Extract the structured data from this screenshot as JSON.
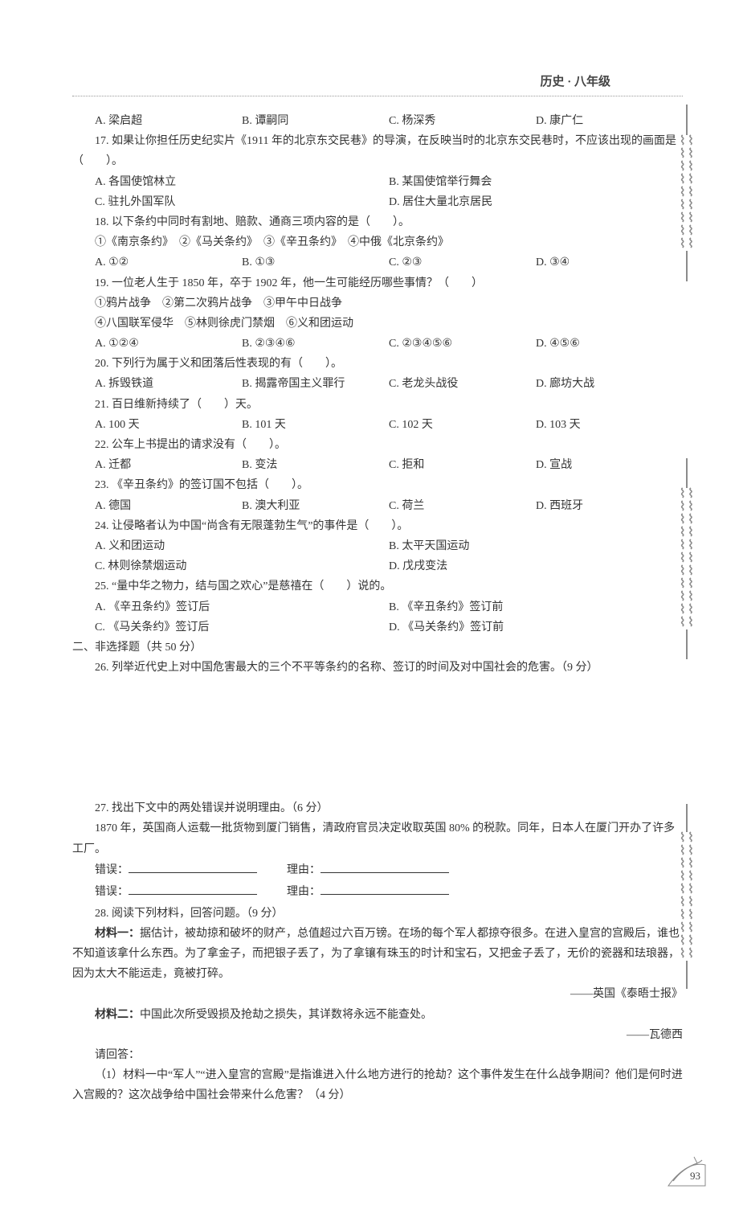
{
  "header": "历史 · 八年级",
  "page_number": "93",
  "q16": {
    "options": {
      "A": "A. 梁启超",
      "B": "B. 谭嗣同",
      "C": "C. 杨深秀",
      "D": "D. 康广仁"
    }
  },
  "q17": {
    "stem": "17. 如果让你担任历史纪实片《1911 年的北京东交民巷》的导演，在反映当时的北京东交民巷时，不应该出现的画面是（　　）。",
    "options": {
      "A": "A. 各国使馆林立",
      "B": "B. 某国使馆举行舞会",
      "C": "C. 驻扎外国军队",
      "D": "D. 居住大量北京居民"
    }
  },
  "q18": {
    "stem": "18. 以下条约中同时有割地、赔款、通商三项内容的是（　　）。",
    "items": "①《南京条约》　②《马关条约》　③《辛丑条约》　④中俄《北京条约》",
    "options": {
      "A": "A. ①②",
      "B": "B. ①③",
      "C": "C. ②③",
      "D": "D. ③④"
    }
  },
  "q19": {
    "stem": "19. 一位老人生于 1850 年，卒于 1902 年，他一生可能经历哪些事情？（　　）",
    "items1": "①鸦片战争　②第二次鸦片战争　③甲午中日战争",
    "items2": "④八国联军侵华　⑤林则徐虎门禁烟　⑥义和团运动",
    "options": {
      "A": "A. ①②④",
      "B": "B. ②③④⑥",
      "C": "C. ②③④⑤⑥",
      "D": "D. ④⑤⑥"
    }
  },
  "q20": {
    "stem": "20. 下列行为属于义和团落后性表现的有（　　）。",
    "options": {
      "A": "A. 拆毁铁道",
      "B": "B. 揭露帝国主义罪行",
      "C": "C. 老龙头战役",
      "D": "D. 廊坊大战"
    }
  },
  "q21": {
    "stem": "21. 百日维新持续了（　　）天。",
    "options": {
      "A": "A. 100 天",
      "B": "B. 101 天",
      "C": "C. 102 天",
      "D": "D. 103 天"
    }
  },
  "q22": {
    "stem": "22. 公车上书提出的请求没有（　　）。",
    "options": {
      "A": "A. 迁都",
      "B": "B. 变法",
      "C": "C. 拒和",
      "D": "D. 宣战"
    }
  },
  "q23": {
    "stem": "23. 《辛丑条约》的签订国不包括（　　）。",
    "options": {
      "A": "A. 德国",
      "B": "B. 澳大利亚",
      "C": "C. 荷兰",
      "D": "D. 西班牙"
    }
  },
  "q24": {
    "stem": "24. 让侵略者认为中国“尚含有无限蓬勃生气”的事件是（　　）。",
    "options": {
      "A": "A. 义和团运动",
      "B": "B. 太平天国运动",
      "C": "C. 林则徐禁烟运动",
      "D": "D. 戊戌变法"
    }
  },
  "q25": {
    "stem": "25. “量中华之物力，结与国之欢心”是慈禧在（　　）说的。",
    "options": {
      "A": "A. 《辛丑条约》签订后",
      "B": "B. 《辛丑条约》签订前",
      "C": "C. 《马关条约》签订后",
      "D": "D. 《马关条约》签订前"
    }
  },
  "section2_heading": "二、非选择题（共 50 分）",
  "q26": {
    "stem": "26. 列举近代史上对中国危害最大的三个不平等条约的名称、签订的时间及对中国社会的危害。（9 分）"
  },
  "q27": {
    "stem": "27. 找出下文中的两处错误并说明理由。（6 分）",
    "passage": "1870 年，英国商人运载一批货物到厦门销售，清政府官员决定收取英国 80% 的税款。同年，日本人在厦门开办了许多工厂。",
    "err_label": "错误：",
    "reason_label": "理由："
  },
  "q28": {
    "stem": "28. 阅读下列材料，回答问题。（9 分）",
    "m1_label": "材料一：",
    "m1_text": "据估计，被劫掠和破坏的财产，总值超过六百万镑。在场的每个军人都掠夺很多。在进入皇宫的宫殿后，谁也不知道该拿什么东西。为了拿金子，而把银子丢了，为了拿镶有珠玉的时计和宝石，又把金子丢了，无价的瓷器和珐琅器，因为太大不能运走，竟被打碎。",
    "m1_source": "——英国《泰晤士报》",
    "m2_label": "材料二：",
    "m2_text": "中国此次所受毁损及抢劫之损失，其详数将永远不能查处。",
    "m2_source": "——瓦德西",
    "answer_heading": "请回答：",
    "sub1": "（1）材料一中“军人”“进入皇宫的宫殿”是指谁进入什么地方进行的抢劫？这个事件发生在什么战争期间？他们是何时进入宫殿的？这次战争给中国社会带来什么危害？（4 分）"
  }
}
